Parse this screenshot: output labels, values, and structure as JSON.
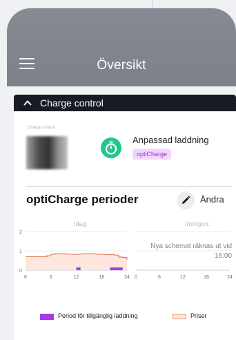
{
  "appbar": {
    "title": "Översikt"
  },
  "card": {
    "header_title": "Charge control",
    "charge_control_label": "Charge control",
    "mode_label": "Anpassad laddning",
    "mode_badge": "optiCharge",
    "section_title": "optiCharge perioder",
    "edit_label": "Ändra"
  },
  "colors": {
    "appbar": "#858a93",
    "card_header": "#181b24",
    "mode_icon_bg": "#22c88a",
    "badge_text": "#9b2bd6",
    "badge_bg": "#f1d8fb",
    "charge_period": "#a73be8",
    "price_line": "#e07a55",
    "price_fill": "#fde6de"
  },
  "icons": {
    "menu": "hamburger-icon",
    "chevron": "chevron-up-icon",
    "mode": "stopwatch-icon",
    "edit": "pencil-icon"
  },
  "chart_data": {
    "type": "area",
    "today_label": "Idag:",
    "tomorrow_label": "Imorgon:",
    "tomorrow_note_line1": "Nya schemat räknas ut vid",
    "tomorrow_note_line2": "16:00",
    "y_ticks": [
      "2",
      "1",
      "0"
    ],
    "x_ticks_today": [
      "0",
      "6",
      "12",
      "18",
      "24"
    ],
    "x_ticks_tomorrow": [
      "0",
      "6",
      "12",
      "18",
      "24"
    ],
    "ylim": [
      0,
      2
    ],
    "xlim": [
      0,
      24
    ],
    "price_series": {
      "x": [
        0,
        1,
        2,
        3,
        4,
        5,
        6,
        7,
        8,
        9,
        10,
        11,
        12,
        13,
        14,
        15,
        16,
        17,
        18,
        19,
        20,
        21,
        22,
        23,
        24
      ],
      "y": [
        0.7,
        0.7,
        0.7,
        0.7,
        0.7,
        0.75,
        0.82,
        0.85,
        0.85,
        0.85,
        0.83,
        0.82,
        0.82,
        0.84,
        0.85,
        0.85,
        0.84,
        0.82,
        0.82,
        0.8,
        0.8,
        0.78,
        0.68,
        0.66,
        0.55
      ]
    },
    "charge_periods": [
      {
        "start": 12,
        "end": 13
      },
      {
        "start": 20,
        "end": 23
      }
    ],
    "legend": [
      {
        "label": "Period för tillgänglig laddning"
      },
      {
        "label": "Priser"
      }
    ]
  }
}
